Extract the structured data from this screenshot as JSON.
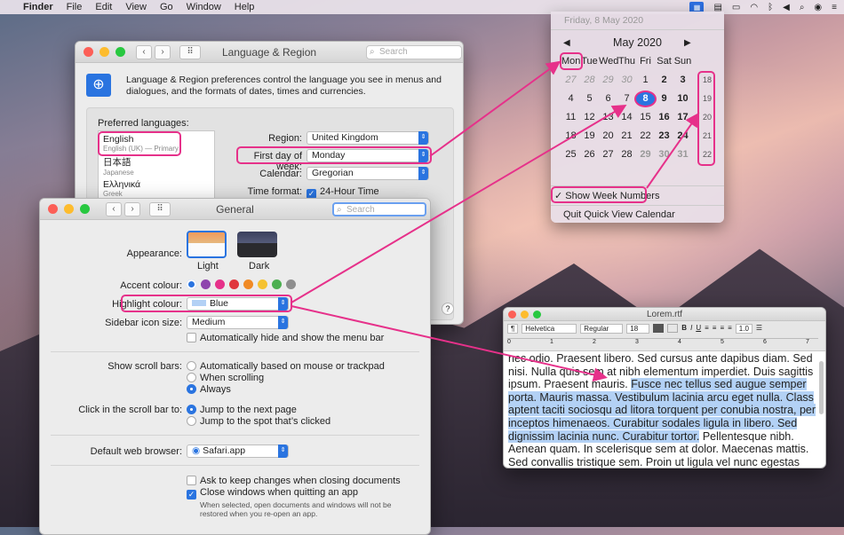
{
  "menubar": {
    "app": "Finder",
    "items": [
      "File",
      "Edit",
      "View",
      "Go",
      "Window",
      "Help"
    ]
  },
  "lang_win": {
    "title": "Language & Region",
    "search_placeholder": "Search",
    "intro": "Language & Region preferences control the language you see in menus and dialogues, and the formats of dates, times and currencies.",
    "preferred_label": "Preferred languages:",
    "languages": [
      {
        "name": "English",
        "sub": "English (UK) — Primary"
      },
      {
        "name": "日本語",
        "sub": "Japanese"
      },
      {
        "name": "Ελληνικά",
        "sub": "Greek"
      }
    ],
    "region_label": "Region:",
    "region_value": "United Kingdom",
    "first_day_label": "First day of week:",
    "first_day_value": "Monday",
    "calendar_label": "Calendar:",
    "calendar_value": "Gregorian",
    "time_label": "Time format:",
    "time_value": "24-Hour Time",
    "help": "?"
  },
  "general_win": {
    "title": "General",
    "search_placeholder": "Search",
    "appearance_label": "Appearance:",
    "appearance_opts": [
      "Light",
      "Dark"
    ],
    "accent_label": "Accent colour:",
    "accent_colors": [
      "#2a74e0",
      "#8e44ad",
      "#e6318a",
      "#e0363d",
      "#f08a24",
      "#f5c231",
      "#4caf50",
      "#8e8e8e"
    ],
    "highlight_label": "Highlight colour:",
    "highlight_value": "Blue",
    "sidebar_label": "Sidebar icon size:",
    "sidebar_value": "Medium",
    "autohide": "Automatically hide and show the menu bar",
    "scroll_label": "Show scroll bars:",
    "scroll_opts": [
      "Automatically based on mouse or trackpad",
      "When scrolling",
      "Always"
    ],
    "click_label": "Click in the scroll bar to:",
    "click_opts": [
      "Jump to the next page",
      "Jump to the spot that’s clicked"
    ],
    "browser_label": "Default web browser:",
    "browser_value": "Safari.app",
    "ask_keep": "Ask to keep changes when closing documents",
    "close_windows": "Close windows when quitting an app",
    "note": "When selected, open documents and windows will not be restored when you re-open an app."
  },
  "calendar": {
    "header": "Friday, 8 May 2020",
    "month": "May 2020",
    "prev": "◀",
    "next": "▶",
    "days": [
      "Mon",
      "Tue",
      "Wed",
      "Thu",
      "Fri",
      "Sat",
      "Sun"
    ],
    "cells": [
      "27",
      "28",
      "29",
      "30",
      "1",
      "2",
      "3",
      "4",
      "5",
      "6",
      "7",
      "8",
      "9",
      "10",
      "11",
      "12",
      "13",
      "14",
      "15",
      "16",
      "17",
      "18",
      "19",
      "20",
      "21",
      "22",
      "23",
      "24",
      "25",
      "26",
      "27",
      "28",
      "29",
      "30",
      "31"
    ],
    "weeks": [
      "18",
      "19",
      "20",
      "21",
      "22"
    ],
    "show_week": "✓ Show Week Numbers",
    "quit": "Quit Quick View Calendar"
  },
  "editor": {
    "title": "Lorem.rtf",
    "font": "Helvetica",
    "style": "Regular",
    "size": "18",
    "spacing": "1.0",
    "ruler_nums": [
      "0",
      "1",
      "2",
      "3",
      "4",
      "5",
      "6",
      "7"
    ],
    "text_pre": "nec odio. Praesent libero. Sed cursus ante dapibus diam. Sed nisi. Nulla quis sem at nibh elementum imperdiet. Duis sagittis ipsum. Praesent mauris. ",
    "text_sel": "Fusce nec tellus sed augue semper porta. Mauris massa. Vestibulum lacinia arcu eget nulla. Class aptent taciti sociosqu ad litora torquent per conubia nostra, per inceptos himenaeos. Curabitur sodales ligula in libero. Sed dignissim lacinia nunc. Curabitur tortor.",
    "text_post": " Pellentesque nibh. Aenean quam. In scelerisque sem at dolor. Maecenas mattis. Sed convallis tristique sem. Proin ut ligula vel nunc egestas porttitor."
  },
  "colors": {
    "annotation": "#e6318a",
    "accent": "#2a74e0",
    "selection": "#b3d1f5"
  }
}
